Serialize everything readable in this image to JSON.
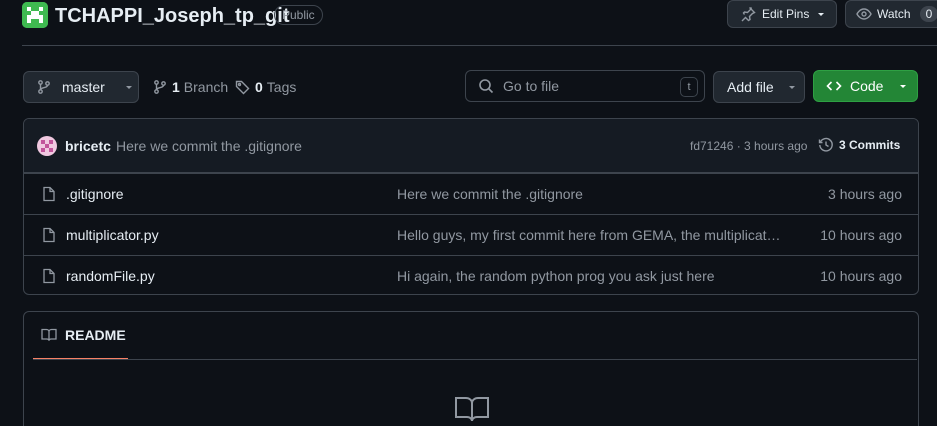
{
  "repo": {
    "name": "TCHAPPI_Joseph_tp_git",
    "visibility": "Public"
  },
  "header": {
    "edit_pins": "Edit Pins",
    "watch": "Watch",
    "watch_count": "0"
  },
  "toolbar": {
    "branch": "master",
    "branch_count": "1",
    "branch_label": "Branch",
    "tag_count": "0",
    "tag_label": "Tags",
    "search_placeholder": "Go to file",
    "search_shortcut": "t",
    "add_file": "Add file",
    "code": "Code"
  },
  "latest_commit": {
    "author": "bricetc",
    "message": "Here we commit the .gitignore",
    "hash_time": "fd71246 · 3 hours ago",
    "commits": "3 Commits"
  },
  "files": [
    {
      "name": ".gitignore",
      "message": "Here we commit the .gitignore",
      "time": "3 hours ago"
    },
    {
      "name": "multiplicator.py",
      "message": "Hello guys, my first commit here from GEMA, the multiplicator program",
      "time": "10 hours ago"
    },
    {
      "name": "randomFile.py",
      "message": "Hi again, the random python prog you ask just here",
      "time": "10 hours ago"
    }
  ],
  "readme": {
    "tab": "README"
  },
  "colors": {
    "accent": "#238636",
    "tab_underline": "#f78166",
    "bg": "#0d1117",
    "border": "#3d444d"
  }
}
